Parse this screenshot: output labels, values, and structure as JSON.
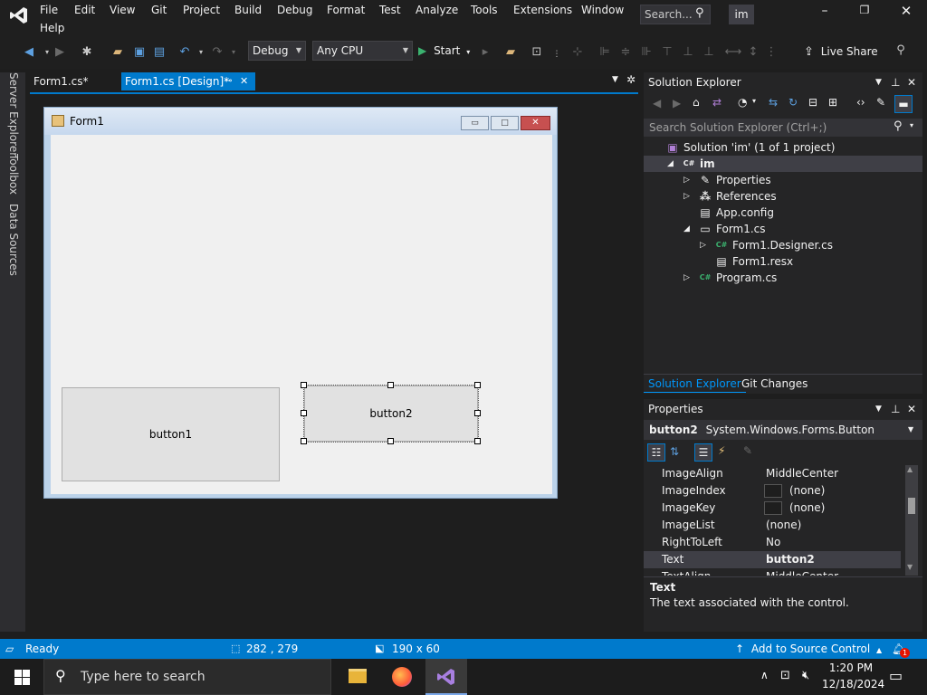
{
  "menu": {
    "items": [
      "File",
      "Edit",
      "View",
      "Git",
      "Project",
      "Build",
      "Debug",
      "Format",
      "Test",
      "Analyze",
      "Tools",
      "Extensions",
      "Window",
      "Help"
    ],
    "search_placeholder": "Search...",
    "profile": "im"
  },
  "toolbar": {
    "config": "Debug",
    "platform": "Any CPU",
    "start_label": "Start",
    "live_share_label": "Live Share"
  },
  "left_tabs": [
    "Server Explorer",
    "Toolbox",
    "Data Sources"
  ],
  "doc_tabs": [
    {
      "label": "Form1.cs*",
      "active": false
    },
    {
      "label": "Form1.cs [Design]*",
      "active": true
    }
  ],
  "form": {
    "title": "Form1",
    "button1_label": "button1",
    "button2_label": "button2"
  },
  "solution_explorer": {
    "title": "Solution Explorer",
    "search_placeholder": "Search Solution Explorer (Ctrl+;)",
    "tree": [
      {
        "label": "Solution 'im' (1 of 1 project)",
        "icon": "solution-icon",
        "indent": 0,
        "expander": ""
      },
      {
        "label": "im",
        "icon": "csharp-project-icon",
        "indent": 1,
        "expander": "▲",
        "bold": true
      },
      {
        "label": "Properties",
        "icon": "wrench-icon",
        "indent": 2,
        "expander": "▷"
      },
      {
        "label": "References",
        "icon": "references-icon",
        "indent": 2,
        "expander": "▷"
      },
      {
        "label": "App.config",
        "icon": "config-file-icon",
        "indent": 2,
        "expander": ""
      },
      {
        "label": "Form1.cs",
        "icon": "form-icon",
        "indent": 2,
        "expander": "▲"
      },
      {
        "label": "Form1.Designer.cs",
        "icon": "cs-file-icon",
        "indent": 3,
        "expander": "▷"
      },
      {
        "label": "Form1.resx",
        "icon": "resx-file-icon",
        "indent": 3,
        "expander": ""
      },
      {
        "label": "Program.cs",
        "icon": "cs-file-icon",
        "indent": 2,
        "expander": "▷"
      }
    ],
    "bottom_tabs": [
      "Solution Explorer",
      "Git Changes"
    ]
  },
  "properties": {
    "title": "Properties",
    "object_name": "button2",
    "object_type": "System.Windows.Forms.Button",
    "rows": [
      {
        "name": "ImageAlign",
        "value": "MiddleCenter",
        "swatch": false,
        "bold": false
      },
      {
        "name": "ImageIndex",
        "value": "(none)",
        "swatch": true,
        "bold": false
      },
      {
        "name": "ImageKey",
        "value": "(none)",
        "swatch": true,
        "bold": false
      },
      {
        "name": "ImageList",
        "value": "(none)",
        "swatch": false,
        "bold": false
      },
      {
        "name": "RightToLeft",
        "value": "No",
        "swatch": false,
        "bold": false
      },
      {
        "name": "Text",
        "value": "button2",
        "swatch": false,
        "bold": true
      },
      {
        "name": "TextAlign",
        "value": "MiddleCenter",
        "swatch": false,
        "bold": false
      }
    ],
    "desc_title": "Text",
    "desc_text": "The text associated with the control."
  },
  "status": {
    "ready": "Ready",
    "position": "282 , 279",
    "size": "190 x 60",
    "source_control": "Add to Source Control",
    "notifications": "1"
  },
  "taskbar": {
    "search_placeholder": "Type here to search",
    "time": "1:20 PM",
    "date": "12/18/2024"
  },
  "colors": {
    "accent": "#007acc",
    "ide_bg": "#1e1e1e",
    "panel_bg": "#252526",
    "selection": "#3f3f46"
  }
}
